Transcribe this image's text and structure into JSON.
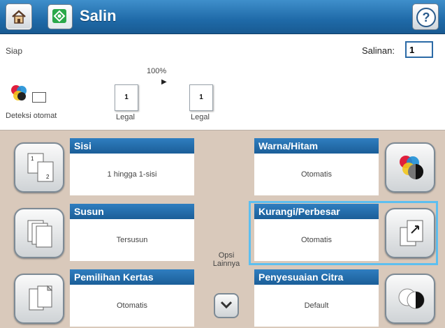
{
  "header": {
    "title": "Salin",
    "home_icon": "home-icon",
    "app_icon": "copy-icon",
    "help_icon": "help-icon"
  },
  "status": {
    "text": "Siap",
    "copies_label": "Salinan:",
    "copies_value": "1",
    "zoom": "100%",
    "detect_label": "Deteksi otomat",
    "source_page": "1",
    "source_label": "Legal",
    "output_page": "1",
    "output_label": "Legal"
  },
  "features": {
    "sides": {
      "title": "Sisi",
      "value": "1 hingga 1-sisi",
      "icon": "sides-icon"
    },
    "collate": {
      "title": "Susun",
      "value": "Tersusun",
      "icon": "collate-icon"
    },
    "paper": {
      "title": "Pemilihan Kertas",
      "value": "Otomatis",
      "icon": "paper-select-icon"
    },
    "color": {
      "title": "Warna/Hitam",
      "value": "Otomatis",
      "icon": "color-black-icon"
    },
    "reduce": {
      "title": "Kurangi/Perbesar",
      "value": "Otomatis",
      "icon": "reduce-enlarge-icon"
    },
    "image": {
      "title": "Penyesuaian Citra",
      "value": "Default",
      "icon": "image-adjust-icon"
    }
  },
  "more_options": {
    "line1": "Opsi",
    "line2": "Lainnya"
  }
}
